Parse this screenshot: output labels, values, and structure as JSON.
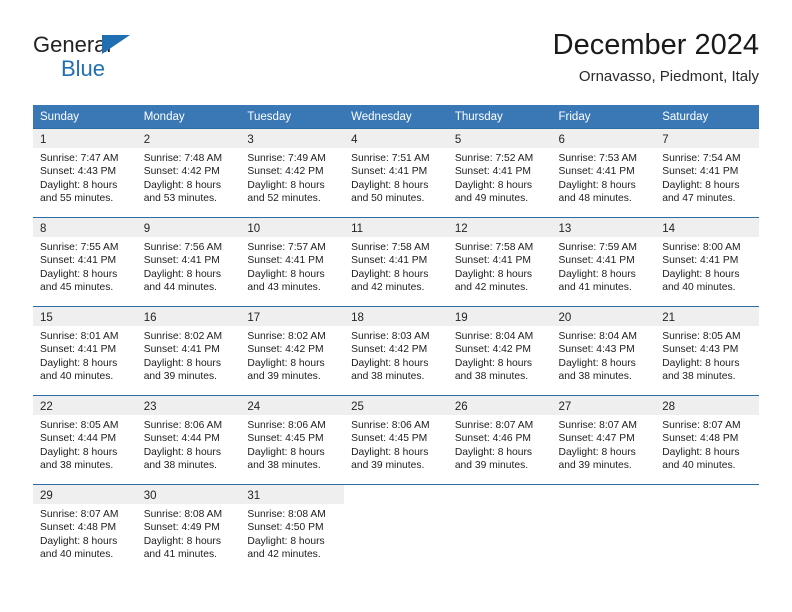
{
  "brand": {
    "name_top": "General",
    "name_bottom": "Blue",
    "accent_color": "#1f6fb2"
  },
  "header": {
    "title": "December 2024",
    "subtitle": "Ornavasso, Piedmont, Italy"
  },
  "theme": {
    "header_bg": "#3a78b5",
    "row_rule": "#2e6da4",
    "daynum_band": "#efefef"
  },
  "weekday_headers": [
    "Sunday",
    "Monday",
    "Tuesday",
    "Wednesday",
    "Thursday",
    "Friday",
    "Saturday"
  ],
  "weeks": [
    [
      {
        "day": "1",
        "sunrise": "Sunrise: 7:47 AM",
        "sunset": "Sunset: 4:43 PM",
        "daylight1": "Daylight: 8 hours",
        "daylight2": "and 55 minutes."
      },
      {
        "day": "2",
        "sunrise": "Sunrise: 7:48 AM",
        "sunset": "Sunset: 4:42 PM",
        "daylight1": "Daylight: 8 hours",
        "daylight2": "and 53 minutes."
      },
      {
        "day": "3",
        "sunrise": "Sunrise: 7:49 AM",
        "sunset": "Sunset: 4:42 PM",
        "daylight1": "Daylight: 8 hours",
        "daylight2": "and 52 minutes."
      },
      {
        "day": "4",
        "sunrise": "Sunrise: 7:51 AM",
        "sunset": "Sunset: 4:41 PM",
        "daylight1": "Daylight: 8 hours",
        "daylight2": "and 50 minutes."
      },
      {
        "day": "5",
        "sunrise": "Sunrise: 7:52 AM",
        "sunset": "Sunset: 4:41 PM",
        "daylight1": "Daylight: 8 hours",
        "daylight2": "and 49 minutes."
      },
      {
        "day": "6",
        "sunrise": "Sunrise: 7:53 AM",
        "sunset": "Sunset: 4:41 PM",
        "daylight1": "Daylight: 8 hours",
        "daylight2": "and 48 minutes."
      },
      {
        "day": "7",
        "sunrise": "Sunrise: 7:54 AM",
        "sunset": "Sunset: 4:41 PM",
        "daylight1": "Daylight: 8 hours",
        "daylight2": "and 47 minutes."
      }
    ],
    [
      {
        "day": "8",
        "sunrise": "Sunrise: 7:55 AM",
        "sunset": "Sunset: 4:41 PM",
        "daylight1": "Daylight: 8 hours",
        "daylight2": "and 45 minutes."
      },
      {
        "day": "9",
        "sunrise": "Sunrise: 7:56 AM",
        "sunset": "Sunset: 4:41 PM",
        "daylight1": "Daylight: 8 hours",
        "daylight2": "and 44 minutes."
      },
      {
        "day": "10",
        "sunrise": "Sunrise: 7:57 AM",
        "sunset": "Sunset: 4:41 PM",
        "daylight1": "Daylight: 8 hours",
        "daylight2": "and 43 minutes."
      },
      {
        "day": "11",
        "sunrise": "Sunrise: 7:58 AM",
        "sunset": "Sunset: 4:41 PM",
        "daylight1": "Daylight: 8 hours",
        "daylight2": "and 42 minutes."
      },
      {
        "day": "12",
        "sunrise": "Sunrise: 7:58 AM",
        "sunset": "Sunset: 4:41 PM",
        "daylight1": "Daylight: 8 hours",
        "daylight2": "and 42 minutes."
      },
      {
        "day": "13",
        "sunrise": "Sunrise: 7:59 AM",
        "sunset": "Sunset: 4:41 PM",
        "daylight1": "Daylight: 8 hours",
        "daylight2": "and 41 minutes."
      },
      {
        "day": "14",
        "sunrise": "Sunrise: 8:00 AM",
        "sunset": "Sunset: 4:41 PM",
        "daylight1": "Daylight: 8 hours",
        "daylight2": "and 40 minutes."
      }
    ],
    [
      {
        "day": "15",
        "sunrise": "Sunrise: 8:01 AM",
        "sunset": "Sunset: 4:41 PM",
        "daylight1": "Daylight: 8 hours",
        "daylight2": "and 40 minutes."
      },
      {
        "day": "16",
        "sunrise": "Sunrise: 8:02 AM",
        "sunset": "Sunset: 4:41 PM",
        "daylight1": "Daylight: 8 hours",
        "daylight2": "and 39 minutes."
      },
      {
        "day": "17",
        "sunrise": "Sunrise: 8:02 AM",
        "sunset": "Sunset: 4:42 PM",
        "daylight1": "Daylight: 8 hours",
        "daylight2": "and 39 minutes."
      },
      {
        "day": "18",
        "sunrise": "Sunrise: 8:03 AM",
        "sunset": "Sunset: 4:42 PM",
        "daylight1": "Daylight: 8 hours",
        "daylight2": "and 38 minutes."
      },
      {
        "day": "19",
        "sunrise": "Sunrise: 8:04 AM",
        "sunset": "Sunset: 4:42 PM",
        "daylight1": "Daylight: 8 hours",
        "daylight2": "and 38 minutes."
      },
      {
        "day": "20",
        "sunrise": "Sunrise: 8:04 AM",
        "sunset": "Sunset: 4:43 PM",
        "daylight1": "Daylight: 8 hours",
        "daylight2": "and 38 minutes."
      },
      {
        "day": "21",
        "sunrise": "Sunrise: 8:05 AM",
        "sunset": "Sunset: 4:43 PM",
        "daylight1": "Daylight: 8 hours",
        "daylight2": "and 38 minutes."
      }
    ],
    [
      {
        "day": "22",
        "sunrise": "Sunrise: 8:05 AM",
        "sunset": "Sunset: 4:44 PM",
        "daylight1": "Daylight: 8 hours",
        "daylight2": "and 38 minutes."
      },
      {
        "day": "23",
        "sunrise": "Sunrise: 8:06 AM",
        "sunset": "Sunset: 4:44 PM",
        "daylight1": "Daylight: 8 hours",
        "daylight2": "and 38 minutes."
      },
      {
        "day": "24",
        "sunrise": "Sunrise: 8:06 AM",
        "sunset": "Sunset: 4:45 PM",
        "daylight1": "Daylight: 8 hours",
        "daylight2": "and 38 minutes."
      },
      {
        "day": "25",
        "sunrise": "Sunrise: 8:06 AM",
        "sunset": "Sunset: 4:45 PM",
        "daylight1": "Daylight: 8 hours",
        "daylight2": "and 39 minutes."
      },
      {
        "day": "26",
        "sunrise": "Sunrise: 8:07 AM",
        "sunset": "Sunset: 4:46 PM",
        "daylight1": "Daylight: 8 hours",
        "daylight2": "and 39 minutes."
      },
      {
        "day": "27",
        "sunrise": "Sunrise: 8:07 AM",
        "sunset": "Sunset: 4:47 PM",
        "daylight1": "Daylight: 8 hours",
        "daylight2": "and 39 minutes."
      },
      {
        "day": "28",
        "sunrise": "Sunrise: 8:07 AM",
        "sunset": "Sunset: 4:48 PM",
        "daylight1": "Daylight: 8 hours",
        "daylight2": "and 40 minutes."
      }
    ],
    [
      {
        "day": "29",
        "sunrise": "Sunrise: 8:07 AM",
        "sunset": "Sunset: 4:48 PM",
        "daylight1": "Daylight: 8 hours",
        "daylight2": "and 40 minutes."
      },
      {
        "day": "30",
        "sunrise": "Sunrise: 8:08 AM",
        "sunset": "Sunset: 4:49 PM",
        "daylight1": "Daylight: 8 hours",
        "daylight2": "and 41 minutes."
      },
      {
        "day": "31",
        "sunrise": "Sunrise: 8:08 AM",
        "sunset": "Sunset: 4:50 PM",
        "daylight1": "Daylight: 8 hours",
        "daylight2": "and 42 minutes."
      },
      {
        "day": "",
        "sunrise": "",
        "sunset": "",
        "daylight1": "",
        "daylight2": ""
      },
      {
        "day": "",
        "sunrise": "",
        "sunset": "",
        "daylight1": "",
        "daylight2": ""
      },
      {
        "day": "",
        "sunrise": "",
        "sunset": "",
        "daylight1": "",
        "daylight2": ""
      },
      {
        "day": "",
        "sunrise": "",
        "sunset": "",
        "daylight1": "",
        "daylight2": ""
      }
    ]
  ]
}
